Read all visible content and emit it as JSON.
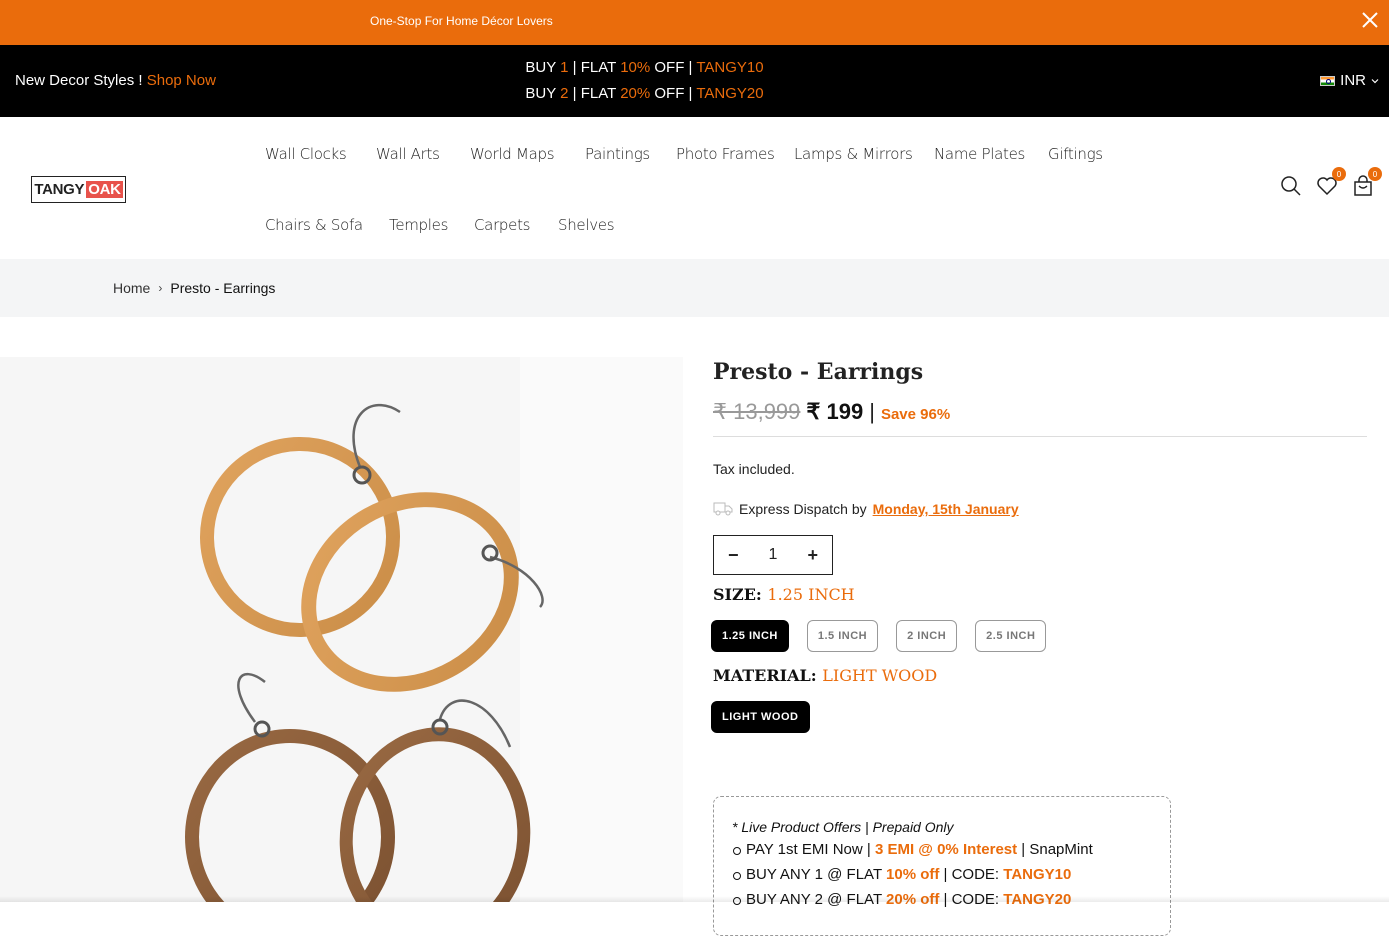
{
  "topbar": {
    "message": "One-Stop For Home Décor Lovers",
    "close_icon": "close-icon"
  },
  "promobar": {
    "left_text": "New Decor Styles !",
    "shop_now": "Shop Now",
    "line1": {
      "buy": "BUY",
      "qty": "1",
      "flat": "| FLAT",
      "pct": "10%",
      "off": "OFF |",
      "code": "TANGY10"
    },
    "line2": {
      "buy": "BUY",
      "qty": "2",
      "flat": "| FLAT",
      "pct": "20%",
      "off": "OFF |",
      "code": "TANGY20"
    },
    "currency": "INR",
    "accent": "#ea6c0c"
  },
  "header": {
    "logo_left": "TANGY",
    "logo_right": "OAK",
    "nav": [
      "Wall Clocks",
      "Wall Arts",
      "World Maps",
      "Paintings",
      "Photo Frames",
      "Lamps & Mirrors",
      "Name Plates",
      "Giftings",
      "Chairs & Sofa",
      "Temples",
      "Carpets",
      "Shelves"
    ],
    "wishlist_count": "0",
    "cart_count": "0"
  },
  "breadcrumb": {
    "home": "Home",
    "current": "Presto - Earrings"
  },
  "product": {
    "title": "Presto - Earrings",
    "old_price": "₹ 13,999",
    "new_price": "₹ 199",
    "separator": "|",
    "save": "Save 96%",
    "tax": "Tax included.",
    "dispatch_label": "Express Dispatch by",
    "dispatch_date": "Monday, 15th January",
    "quantity": "1",
    "size_label": "SIZE:",
    "size_value": "1.25 INCH",
    "sizes": [
      "1.25 INCH",
      "1.5 INCH",
      "2 INCH",
      "2.5 INCH"
    ],
    "material_label": "MATERIAL:",
    "material_value": "LIGHT WOOD",
    "materials": [
      "LIGHT WOOD"
    ]
  },
  "offers": {
    "title": "* Live Product Offers | Prepaid Only",
    "items": [
      {
        "pre": "PAY 1st EMI Now |",
        "hl": "3 EMI @ 0% Interest",
        "post": "| SnapMint"
      },
      {
        "pre": "BUY ANY 1 @ FLAT",
        "hl": "10% off",
        "post": "| CODE:",
        "code": "TANGY10"
      },
      {
        "pre": "BUY ANY 2 @ FLAT",
        "hl": "20% off",
        "post": "| CODE:",
        "code": "TANGY20"
      }
    ]
  }
}
